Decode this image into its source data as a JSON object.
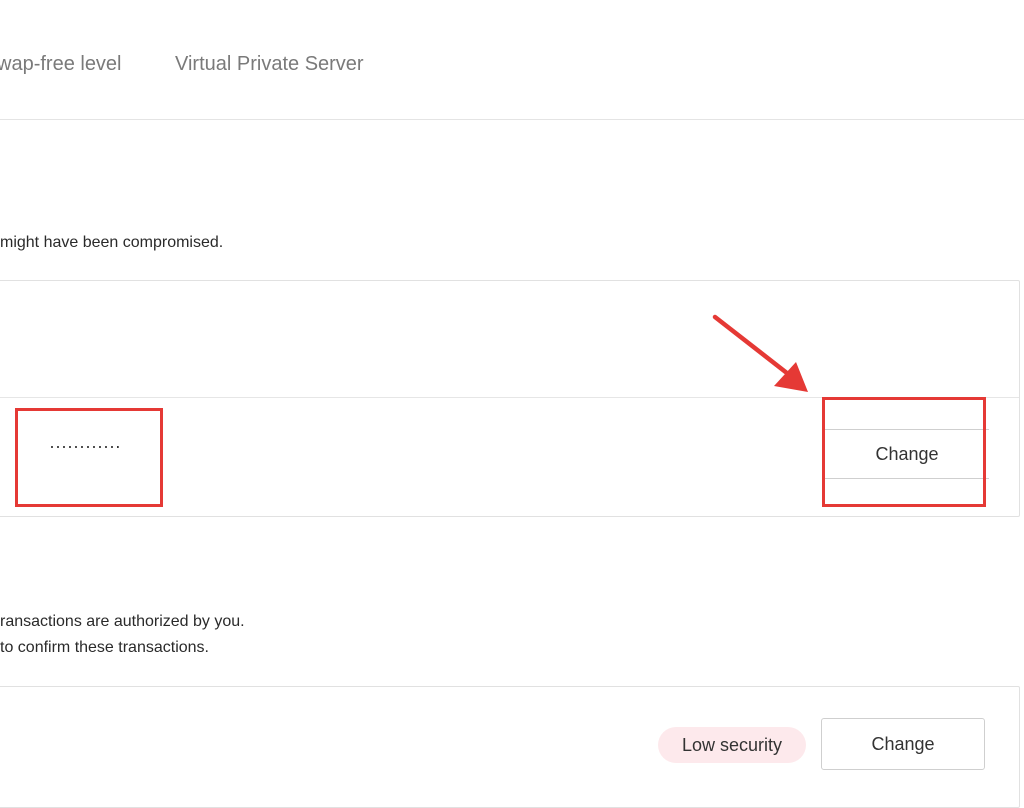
{
  "tabs": {
    "swap_free": "wap-free level",
    "vps": "Virtual Private Server"
  },
  "password_section": {
    "description": "might have been compromised.",
    "masked_value": "············",
    "change_label": "Change"
  },
  "transaction_section": {
    "description_line1": "ransactions are authorized by you.",
    "description_line2": "to confirm these transactions.",
    "badge": "Low security",
    "change_label": "Change"
  },
  "colors": {
    "annotation": "#e53935",
    "badge_bg": "#fde9ec"
  }
}
